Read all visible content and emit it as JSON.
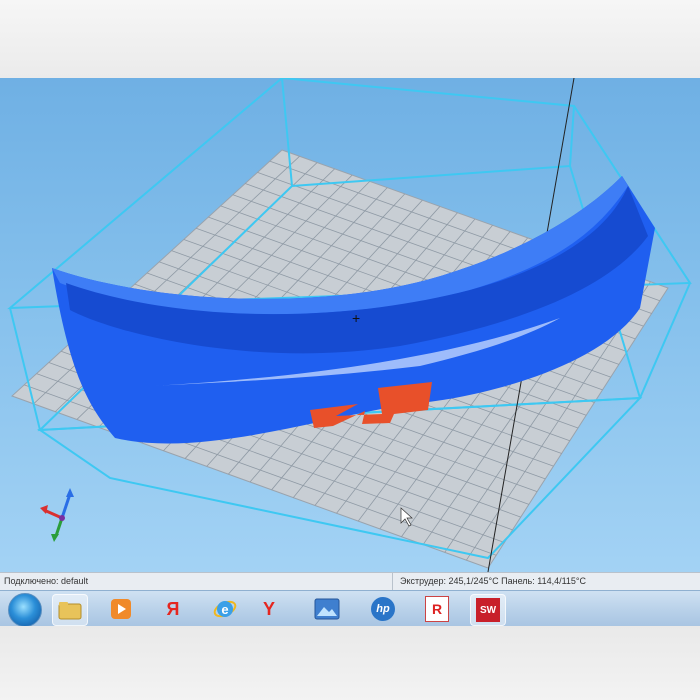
{
  "viewport": {
    "cursor": "+"
  },
  "statusbar": {
    "connection": "Подключено: default",
    "temperatures": "Экструдер: 245,1/245°C Панель: 114,4/115°C"
  },
  "taskbar": {
    "items": [
      {
        "name": "start-button",
        "label": ""
      },
      {
        "name": "explorer-icon",
        "label": ""
      },
      {
        "name": "media-player-icon",
        "label": ""
      },
      {
        "name": "yandex-icon",
        "label": "Я"
      },
      {
        "name": "internet-explorer-icon",
        "label": "e"
      },
      {
        "name": "yandex-browser-icon",
        "label": "Y"
      },
      {
        "name": "picture-viewer-icon",
        "label": ""
      },
      {
        "name": "hp-icon",
        "label": "hp"
      },
      {
        "name": "repetier-icon",
        "label": "R"
      },
      {
        "name": "solidworks-icon",
        "label": "SW"
      }
    ]
  },
  "colors": {
    "part": "#1f5ff0",
    "logo": "#e8502a",
    "bounding_box": "#3ec8f2",
    "grid": "#8f9aa5"
  }
}
